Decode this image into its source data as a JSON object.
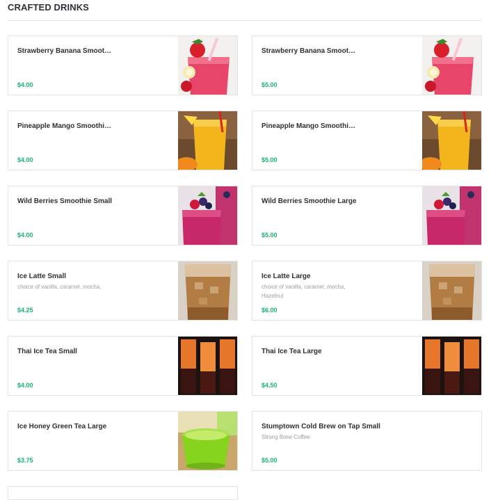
{
  "section": {
    "title": "CRAFTED DRINKS"
  },
  "items": [
    {
      "name": "Strawberry Banana Smoothie Small",
      "description": "",
      "price": "$4.00",
      "image": "strawberry-banana-smoothie"
    },
    {
      "name": "Strawberry Banana Smoothie Large",
      "description": "",
      "price": "$5.00",
      "image": "strawberry-banana-smoothie"
    },
    {
      "name": "Pineapple Mango Smoothie Small",
      "description": "",
      "price": "$4.00",
      "image": "pineapple-mango-smoothie"
    },
    {
      "name": "Pineapple Mango Smoothie Large",
      "description": "",
      "price": "$5.00",
      "image": "pineapple-mango-smoothie"
    },
    {
      "name": "Wild Berries Smoothie Small",
      "description": "",
      "price": "$4.00",
      "image": "wild-berries-smoothie"
    },
    {
      "name": "Wild Berries Smoothie Large",
      "description": "",
      "price": "$5.00",
      "image": "wild-berries-smoothie"
    },
    {
      "name": "Ice Latte Small",
      "description": "choice of vanilla, caramel, mocha,",
      "price": "$4.25",
      "image": "ice-latte"
    },
    {
      "name": "Ice Latte Large",
      "description": "choice of vanilla, caramel, mocha, Hazelnut",
      "price": "$6.00",
      "image": "ice-latte"
    },
    {
      "name": "Thai Ice Tea Small",
      "description": "",
      "price": "$4.00",
      "image": "thai-ice-tea"
    },
    {
      "name": "Thai Ice Tea Large",
      "description": "",
      "price": "$4.50",
      "image": "thai-ice-tea"
    },
    {
      "name": "Ice Honey Green Tea Large",
      "description": "",
      "price": "$3.75",
      "image": "honey-green-tea"
    },
    {
      "name": "Stumptown Cold Brew on Tap Small",
      "description": "Strong Brew Coffee",
      "price": "$5.00",
      "image": ""
    }
  ],
  "colors": {
    "price": "#18b470",
    "text": "#2d3035",
    "muted": "#9a9ea5",
    "border": "#e4e4e4"
  }
}
